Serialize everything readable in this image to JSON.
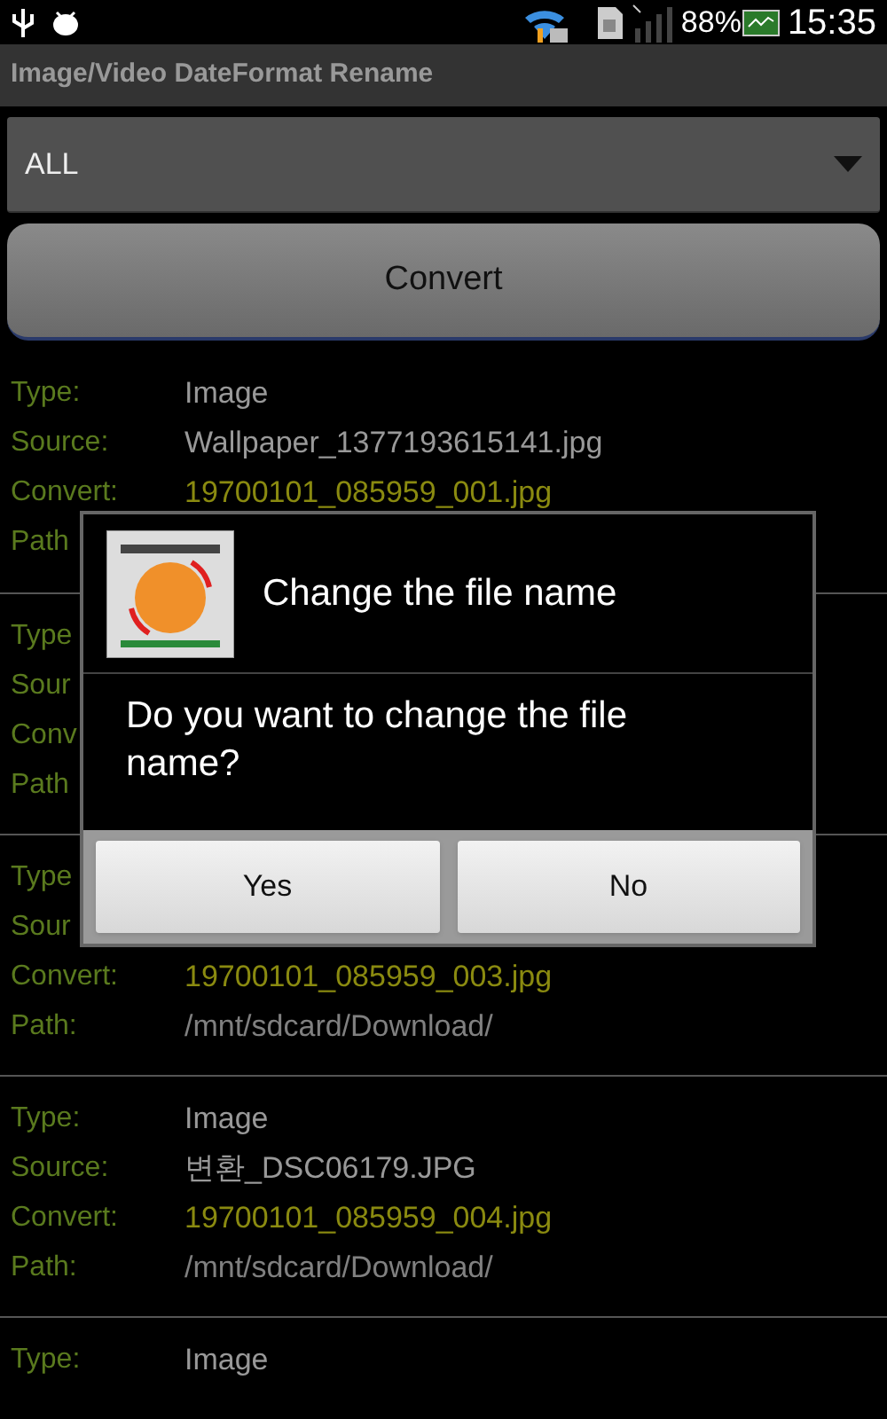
{
  "status_bar": {
    "battery_text": "88%",
    "time": "15:35"
  },
  "title": "Image/Video DateFormat Rename",
  "filter": {
    "value": "ALL"
  },
  "convert_button": "Convert",
  "entries": [
    {
      "fields": [
        {
          "kind": "type",
          "label": "Type:",
          "value": "Image"
        },
        {
          "kind": "source",
          "label": "Source:",
          "value": "Wallpaper_1377193615141.jpg"
        },
        {
          "kind": "convert",
          "label": "Convert:",
          "value": "19700101_085959_001.jpg"
        },
        {
          "kind": "path",
          "label": "Path"
        }
      ]
    },
    {
      "fields": [
        {
          "kind": "type",
          "label": "Type"
        },
        {
          "kind": "source",
          "label": "Sour"
        },
        {
          "kind": "convert",
          "label": "Conv"
        },
        {
          "kind": "path",
          "label": "Path"
        }
      ]
    },
    {
      "fields": [
        {
          "kind": "type",
          "label": "Type"
        },
        {
          "kind": "source",
          "label": "Sour"
        },
        {
          "kind": "convert",
          "label": "Convert:",
          "value": "19700101_085959_003.jpg"
        },
        {
          "kind": "path",
          "label": "Path:",
          "value": "/mnt/sdcard/Download/"
        }
      ]
    },
    {
      "fields": [
        {
          "kind": "type",
          "label": "Type:",
          "value": "Image"
        },
        {
          "kind": "source",
          "label": "Source:",
          "value": "변환_DSC06179.JPG"
        },
        {
          "kind": "convert",
          "label": "Convert:",
          "value": "19700101_085959_004.jpg"
        },
        {
          "kind": "path",
          "label": "Path:",
          "value": "/mnt/sdcard/Download/"
        }
      ]
    },
    {
      "fields": [
        {
          "kind": "type",
          "label": "Type:",
          "value": "Image"
        }
      ]
    }
  ],
  "dialog": {
    "title": "Change the file name",
    "message": "Do you want to change the file name?",
    "buttons": [
      "Yes",
      "No"
    ]
  }
}
